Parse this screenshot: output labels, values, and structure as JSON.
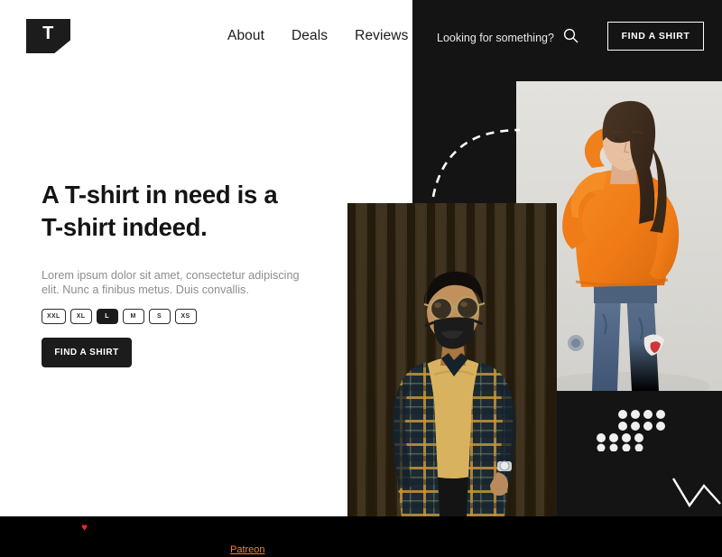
{
  "brand": {
    "logo_letter": "T",
    "logo_name": "t-logo"
  },
  "header": {
    "nav": [
      {
        "label": "About"
      },
      {
        "label": "Deals"
      },
      {
        "label": "Reviews"
      }
    ],
    "search_label": "Looking for something?",
    "search_icon": "search-icon",
    "cta_label": "FIND A SHIRT"
  },
  "hero": {
    "heading_line1": "A T-shirt in need is a",
    "heading_line2": "T-shirt indeed.",
    "paragraph": "Lorem ipsum dolor sit amet, consectetur adipiscing elit. Nunc a finibus metus. Duis convallis.",
    "sizes": [
      {
        "label": "XXL",
        "selected": false
      },
      {
        "label": "XL",
        "selected": false
      },
      {
        "label": "L",
        "selected": true
      },
      {
        "label": "M",
        "selected": false
      },
      {
        "label": "S",
        "selected": false
      },
      {
        "label": "XS",
        "selected": false
      }
    ],
    "cta_label": "FIND A SHIRT"
  },
  "media": {
    "photo_woman": "woman in orange sweater and blue jeans",
    "photo_man": "man in plaid shirt with face mask and sunglasses"
  },
  "decorations": {
    "dashed_arc": "dashed-arc-decoration",
    "zigzag": "zigzag-decoration",
    "dot_grid": "dot-grid-decoration"
  },
  "footer": {
    "heart": "♥",
    "patreon_label": "Patreon"
  },
  "colors": {
    "dark": "#141414",
    "accent_orange": "#f1842a",
    "heart_red": "#e8272b",
    "muted_text": "#8d8d8d",
    "white": "#ffffff"
  }
}
